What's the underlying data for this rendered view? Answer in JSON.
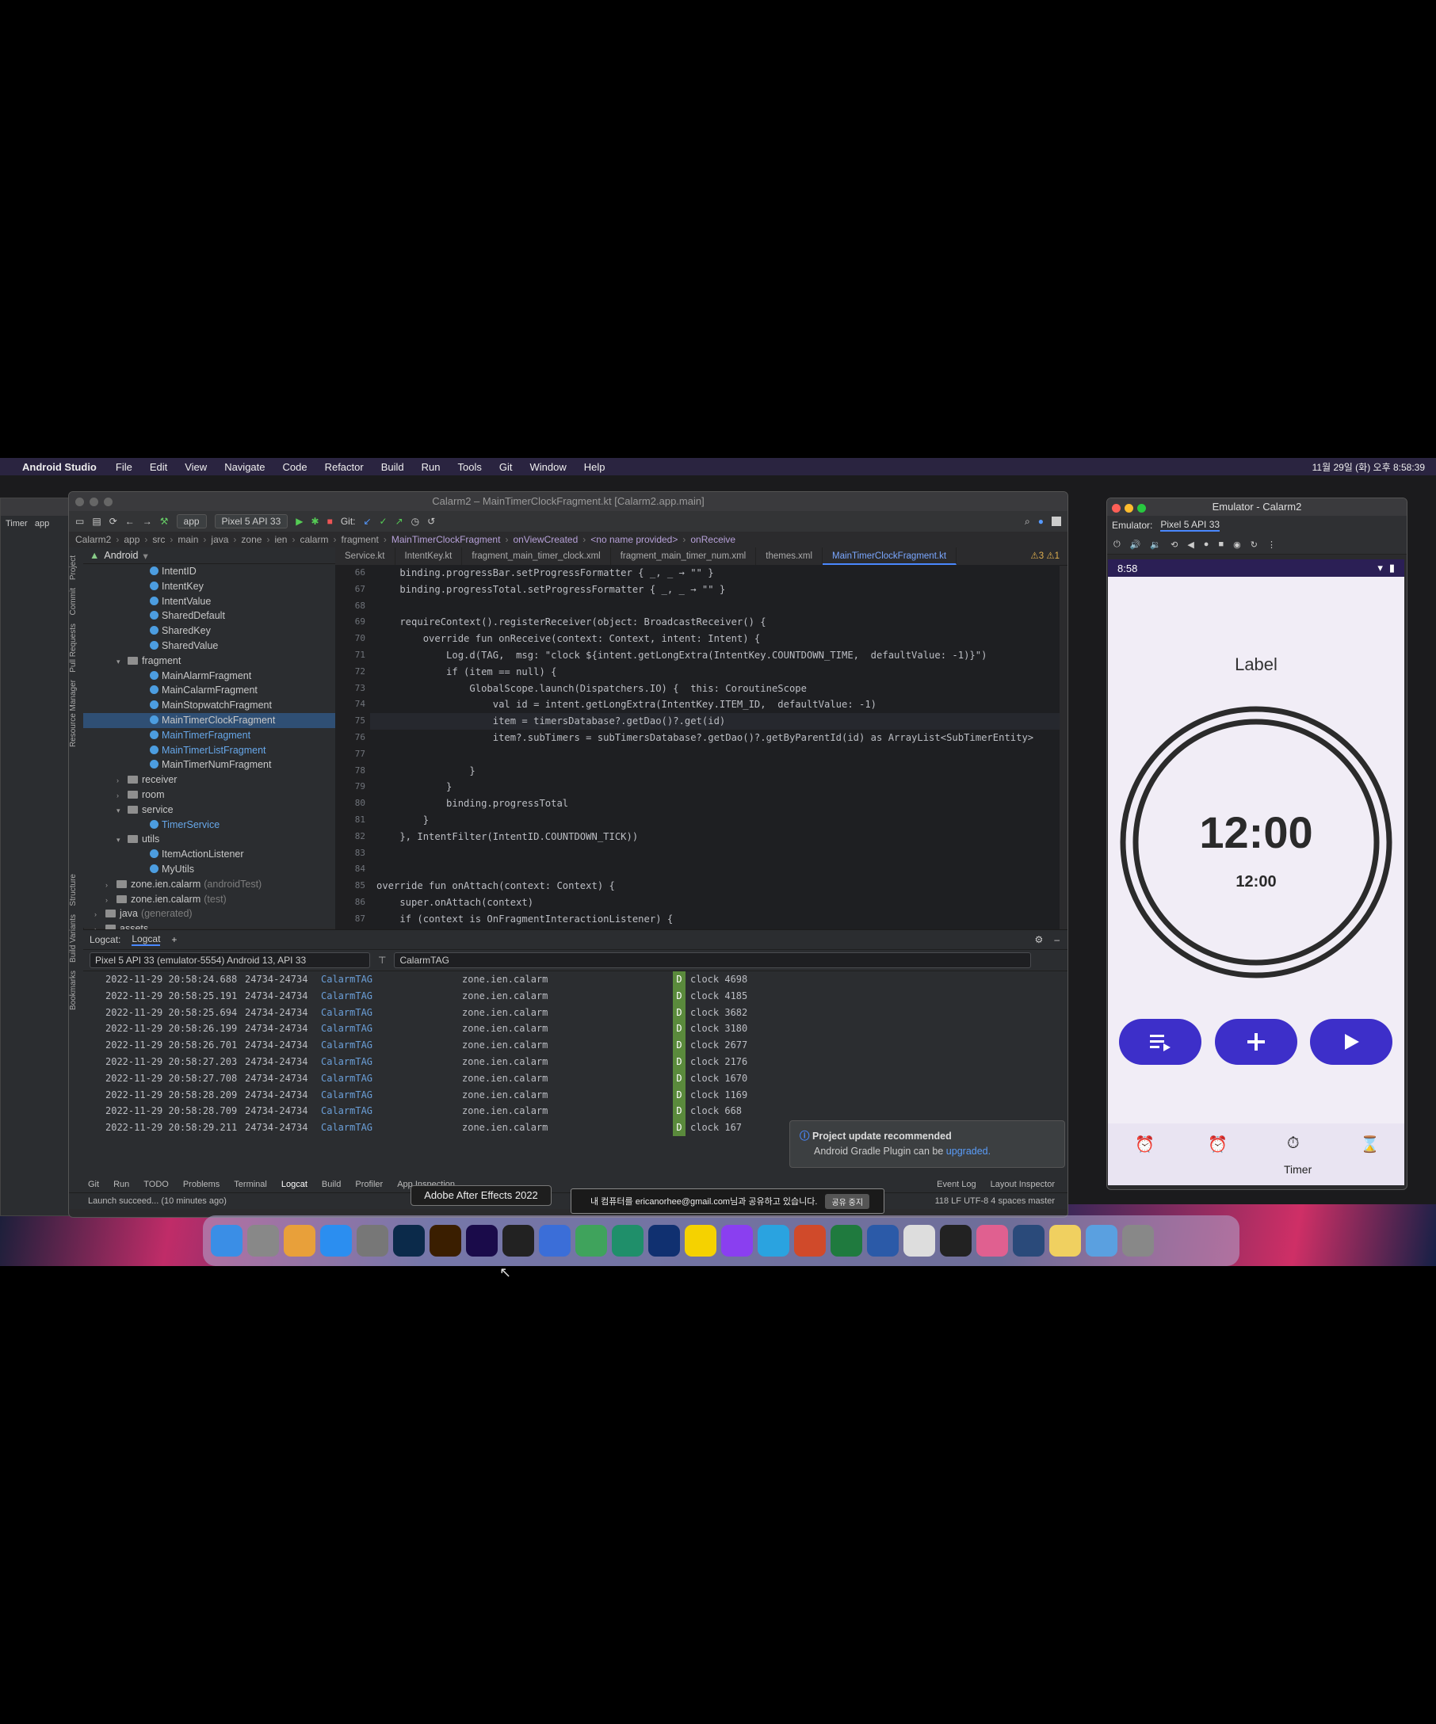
{
  "menubar": {
    "app": "Android Studio",
    "items": [
      "File",
      "Edit",
      "View",
      "Navigate",
      "Code",
      "Refactor",
      "Build",
      "Run",
      "Tools",
      "Git",
      "Window",
      "Help"
    ],
    "clock": "11월 29일 (화) 오후 8:58:39"
  },
  "ide": {
    "title": "Calarm2 – MainTimerClockFragment.kt [Calarm2.app.main]",
    "toolbar": {
      "config": "app",
      "device": "Pixel 5 API 33",
      "git": "Git:"
    },
    "breadcrumb": [
      "Calarm2",
      "app",
      "src",
      "main",
      "java",
      "zone",
      "ien",
      "calarm",
      "fragment",
      "MainTimerClockFragment",
      "onViewCreated",
      "<no name provided>",
      "onReceive"
    ],
    "project_view": "Android",
    "tree": [
      {
        "label": "IntentID",
        "type": "class",
        "indent": 5
      },
      {
        "label": "IntentKey",
        "type": "class",
        "indent": 5
      },
      {
        "label": "IntentValue",
        "type": "class",
        "indent": 5
      },
      {
        "label": "SharedDefault",
        "type": "class",
        "indent": 5
      },
      {
        "label": "SharedKey",
        "type": "class",
        "indent": 5
      },
      {
        "label": "SharedValue",
        "type": "class",
        "indent": 5
      },
      {
        "label": "fragment",
        "type": "folder",
        "indent": 3,
        "open": true
      },
      {
        "label": "MainAlarmFragment",
        "type": "class",
        "indent": 5
      },
      {
        "label": "MainCalarmFragment",
        "type": "class",
        "indent": 5
      },
      {
        "label": "MainStopwatchFragment",
        "type": "class",
        "indent": 5
      },
      {
        "label": "MainTimerClockFragment",
        "type": "class",
        "indent": 5,
        "selected": true
      },
      {
        "label": "MainTimerFragment",
        "type": "class",
        "indent": 5,
        "blue": true
      },
      {
        "label": "MainTimerListFragment",
        "type": "class",
        "indent": 5,
        "blue": true
      },
      {
        "label": "MainTimerNumFragment",
        "type": "class",
        "indent": 5
      },
      {
        "label": "receiver",
        "type": "folder",
        "indent": 3
      },
      {
        "label": "room",
        "type": "folder",
        "indent": 3
      },
      {
        "label": "service",
        "type": "folder",
        "indent": 3,
        "open": true
      },
      {
        "label": "TimerService",
        "type": "class",
        "indent": 5,
        "blue": true
      },
      {
        "label": "utils",
        "type": "folder",
        "indent": 3,
        "open": true
      },
      {
        "label": "ItemActionListener",
        "type": "class",
        "indent": 5
      },
      {
        "label": "MyUtils",
        "type": "class",
        "indent": 5
      },
      {
        "label": "zone.ien.calarm",
        "suffix": "(androidTest)",
        "type": "folder",
        "indent": 2
      },
      {
        "label": "zone.ien.calarm",
        "suffix": "(test)",
        "type": "folder",
        "indent": 2
      },
      {
        "label": "java",
        "suffix": "(generated)",
        "type": "folder",
        "indent": 1
      },
      {
        "label": "assets",
        "type": "folder",
        "indent": 1
      }
    ],
    "tabs": [
      "Service.kt",
      "IntentKey.kt",
      "fragment_main_timer_clock.xml",
      "fragment_main_timer_num.xml",
      "themes.xml",
      "MainTimerClockFragment.kt"
    ],
    "warnings": "⚠3 ⚠1",
    "line_numbers": [
      "66",
      "67",
      "68",
      "69",
      "70",
      "71",
      "72",
      "73",
      "74",
      "75",
      "76",
      "77",
      "78",
      "79",
      "80",
      "81",
      "82",
      "83",
      "84",
      "85",
      "86",
      "87"
    ],
    "code": [
      "    binding.progressBar.setProgressFormatter { _, _ → \"\" }",
      "    binding.progressTotal.setProgressFormatter { _, _ → \"\" }",
      "",
      "    requireContext().registerReceiver(object: BroadcastReceiver() {",
      "        override fun onReceive(context: Context, intent: Intent) {",
      "            Log.d(TAG,  msg: \"clock ${intent.getLongExtra(IntentKey.COUNTDOWN_TIME,  defaultValue: -1)}\")",
      "            if (item == null) {",
      "                GlobalScope.launch(Dispatchers.IO) {  this: CoroutineScope",
      "                    val id = intent.getLongExtra(IntentKey.ITEM_ID,  defaultValue: -1)",
      "                    item = timersDatabase?.getDao()?.get(id)",
      "                    item?.subTimers = subTimersDatabase?.getDao()?.getByParentId(id) as ArrayList<SubTimerEntity>",
      "",
      "                }",
      "            }",
      "            binding.progressTotal",
      "        }",
      "    }, IntentFilter(IntentID.COUNTDOWN_TICK))",
      "",
      "",
      "override fun onAttach(context: Context) {",
      "    super.onAttach(context)",
      "    if (context is OnFragmentInteractionListener) {"
    ],
    "logcat": {
      "tabs": [
        "Logcat:",
        "Logcat"
      ],
      "device": "Pixel 5 API 33 (emulator-5554) Android 13, API 33",
      "filter": "CalarmTAG",
      "rows": [
        {
          "time": "2022-11-29 20:58:24.688",
          "pid": "24734-24734",
          "tag": "CalarmTAG",
          "pkg": "zone.ien.calarm",
          "lvl": "D",
          "msg": "clock 4698"
        },
        {
          "time": "2022-11-29 20:58:25.191",
          "pid": "24734-24734",
          "tag": "CalarmTAG",
          "pkg": "zone.ien.calarm",
          "lvl": "D",
          "msg": "clock 4185"
        },
        {
          "time": "2022-11-29 20:58:25.694",
          "pid": "24734-24734",
          "tag": "CalarmTAG",
          "pkg": "zone.ien.calarm",
          "lvl": "D",
          "msg": "clock 3682"
        },
        {
          "time": "2022-11-29 20:58:26.199",
          "pid": "24734-24734",
          "tag": "CalarmTAG",
          "pkg": "zone.ien.calarm",
          "lvl": "D",
          "msg": "clock 3180"
        },
        {
          "time": "2022-11-29 20:58:26.701",
          "pid": "24734-24734",
          "tag": "CalarmTAG",
          "pkg": "zone.ien.calarm",
          "lvl": "D",
          "msg": "clock 2677"
        },
        {
          "time": "2022-11-29 20:58:27.203",
          "pid": "24734-24734",
          "tag": "CalarmTAG",
          "pkg": "zone.ien.calarm",
          "lvl": "D",
          "msg": "clock 2176"
        },
        {
          "time": "2022-11-29 20:58:27.708",
          "pid": "24734-24734",
          "tag": "CalarmTAG",
          "pkg": "zone.ien.calarm",
          "lvl": "D",
          "msg": "clock 1670"
        },
        {
          "time": "2022-11-29 20:58:28.209",
          "pid": "24734-24734",
          "tag": "CalarmTAG",
          "pkg": "zone.ien.calarm",
          "lvl": "D",
          "msg": "clock 1169"
        },
        {
          "time": "2022-11-29 20:58:28.709",
          "pid": "24734-24734",
          "tag": "CalarmTAG",
          "pkg": "zone.ien.calarm",
          "lvl": "D",
          "msg": "clock 668"
        },
        {
          "time": "2022-11-29 20:58:29.211",
          "pid": "24734-24734",
          "tag": "CalarmTAG",
          "pkg": "zone.ien.calarm",
          "lvl": "D",
          "msg": "clock 167"
        }
      ]
    },
    "notification": {
      "title": "Project update recommended",
      "body": "Android Gradle Plugin can be",
      "link": "upgraded."
    },
    "tool_windows": [
      "Git",
      "Run",
      "TODO",
      "Problems",
      "Terminal",
      "Logcat",
      "Build",
      "Profiler",
      "App Inspection"
    ],
    "tool_windows_right": [
      "Event Log",
      "Layout Inspector"
    ],
    "status": {
      "left": "Launch succeed... (10 minutes ago)",
      "right": "118  LF  UTF-8  4 spaces  master"
    },
    "side_labels": [
      "Project",
      "Commit",
      "Pull Requests",
      "Resource Manager",
      "Structure",
      "Build Variants",
      "Bookmarks"
    ]
  },
  "tooltip": "Adobe After Effects 2022",
  "sharing": {
    "text": "내 컴퓨터를 ericanorhee@gmail.com님과 공유하고 있습니다.",
    "button": "공유 중지"
  },
  "emulator": {
    "title": "Emulator - Calarm2",
    "label": "Emulator:",
    "device": "Pixel 5 API 33",
    "phone": {
      "time": "8:58",
      "label": "Label",
      "main_time": "12:00",
      "sub_time": "12:00",
      "nav_label": "Timer",
      "accent": "#3d2fc9"
    }
  },
  "dock_apps": [
    "Finder",
    "Launchpad",
    "Chrome",
    "App Store",
    "Settings",
    "Ps",
    "Ai",
    "Ae",
    "Terminal",
    "Xcode",
    "Android Studio",
    "PyCharm",
    "AC",
    "KakaoTalk",
    "Messenger",
    "Telegram",
    "PowerPoint",
    "Excel",
    "Word",
    "Finder2",
    "Notion",
    "Photos",
    "QuickTime",
    "Notes",
    "Preview",
    "Trash"
  ],
  "back_window": {
    "title": "Timer",
    "tab": "app"
  }
}
